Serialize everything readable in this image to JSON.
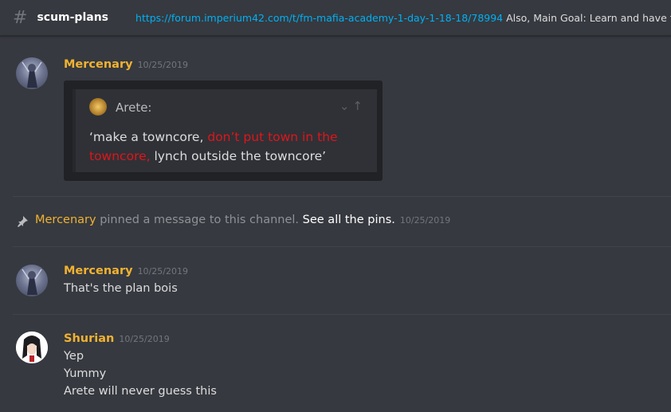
{
  "channel": {
    "name": "scum-plans",
    "topic_link": "https://forum.imperium42.com/t/fm-mafia-academy-1-day-1-18-18/78994",
    "topic_text": " Also, Main Goal: Learn and have fun!"
  },
  "messages": [
    {
      "author": "Mercenary",
      "timestamp": "10/25/2019",
      "quote": {
        "author": "Arete:",
        "text_before": "‘make a towncore, ",
        "text_red": "don’t put town in the towncore,",
        "text_after": " lynch outside the towncore’"
      }
    },
    {
      "system": {
        "author": "Mercenary",
        "action": " pinned a message to this channel. ",
        "link": "See all the pins.",
        "timestamp": "10/25/2019"
      }
    },
    {
      "author": "Mercenary",
      "timestamp": "10/25/2019",
      "lines": [
        "That's the plan bois"
      ]
    },
    {
      "author": "Shurian",
      "timestamp": "10/25/2019",
      "lines": [
        "Yep",
        "Yummy",
        "Arete will never guess this"
      ]
    }
  ],
  "icons": {
    "channel": "hash-icon",
    "pin": "pin-icon",
    "expand": "chevron-down-icon",
    "jump": "arrow-up-icon"
  },
  "colors": {
    "background": "#36393f",
    "username": "#f0b232",
    "link": "#00b0f4",
    "quote_highlight": "#e0151b"
  }
}
